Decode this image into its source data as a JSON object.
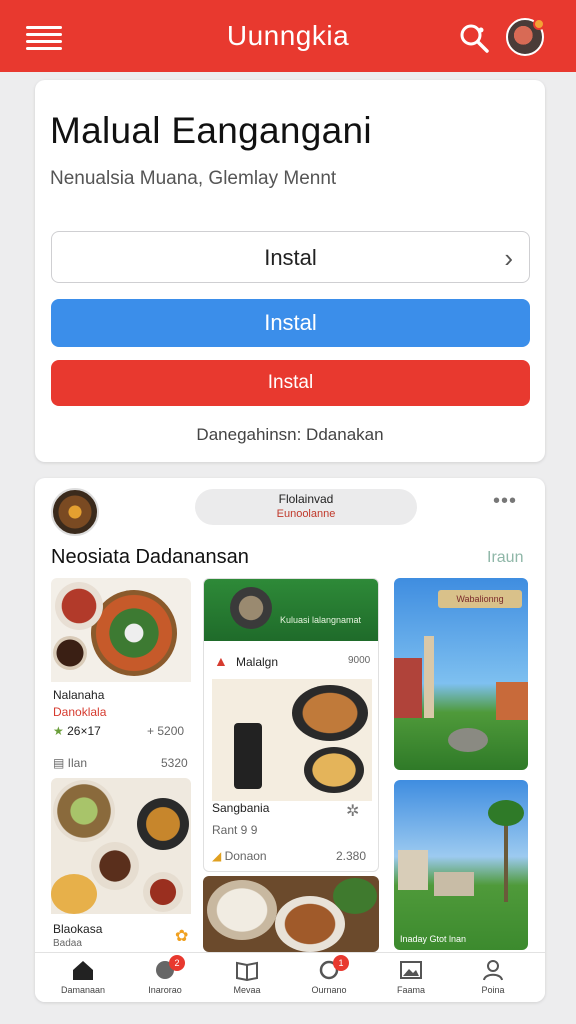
{
  "header": {
    "title": "Uunngkia",
    "menu_icon": "menu-icon",
    "search_icon": "search-icon",
    "avatar_icon": "user-avatar"
  },
  "hero": {
    "title": "Malual Eangangani",
    "subtitle": "Nenualsia Muana, Glemlay Mennt",
    "buttons": {
      "outline_label": "Instal",
      "primary_label": "Instal",
      "danger_label": "Instal"
    },
    "footer_link": "Danegahinsn: Ddanakan"
  },
  "feed": {
    "pill_title": "Flolainvad",
    "pill_sub": "Eunoolanne",
    "more": "•••",
    "section_title": "Neosiata Dadanansan",
    "section_link": "Iraun",
    "col1": {
      "item1_title": "Nalanaha",
      "item1_sub": "Danoklala",
      "item1_rating": "26×17",
      "item1_price": "+ 5200",
      "item1_meta_left": "Ilan",
      "item1_meta_right": "5320",
      "item2_title": "Blaokasa",
      "item2_sub": "Badaa"
    },
    "col2": {
      "banner_text": "Kuluasi lalangnamat",
      "card_title": "Malalgn",
      "card_tag": "9000",
      "item_title": "Sangbania",
      "item_sub": "Rant 9 9",
      "item_meta_left": "Donaon",
      "item_meta_right": "2.380"
    },
    "col3": {
      "banner": "Wabalionng",
      "caption": "Inaday Gtot lnan"
    }
  },
  "bottom_nav": [
    {
      "label": "Damanaan",
      "icon": "home-icon",
      "badge": ""
    },
    {
      "label": "Inarorao",
      "icon": "chat-icon",
      "badge": "2"
    },
    {
      "label": "Mevaa",
      "icon": "book-icon",
      "badge": ""
    },
    {
      "label": "Ournano",
      "icon": "message-icon",
      "badge": "1"
    },
    {
      "label": "Faama",
      "icon": "image-icon",
      "badge": ""
    },
    {
      "label": "Poina",
      "icon": "profile-icon",
      "badge": ""
    }
  ],
  "colors": {
    "brand_red": "#e8392f",
    "primary_blue": "#3b8eea",
    "background": "#ededee"
  }
}
